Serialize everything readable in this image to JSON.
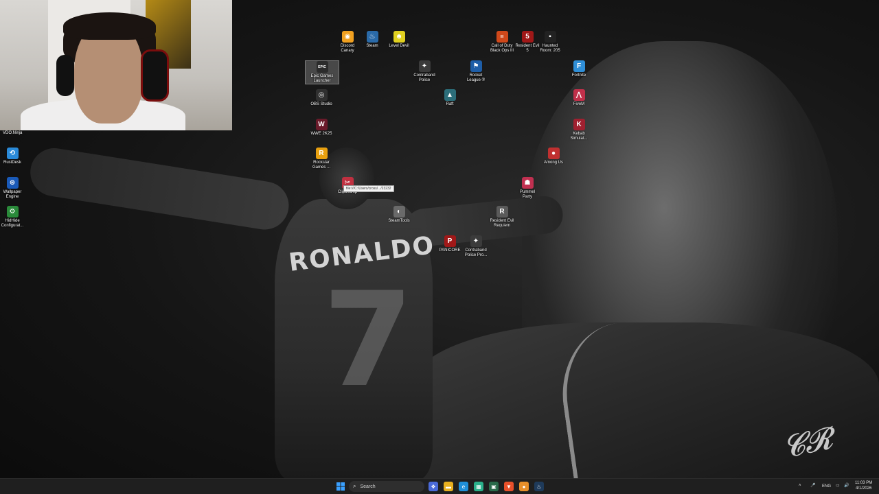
{
  "wallpaper": {
    "jersey_name": "RONALDO",
    "jersey_number": "7",
    "signature": "CR7"
  },
  "webcam": {
    "label": "VDO.Ninja"
  },
  "tooltip": {
    "text": "file:///C:/Users/cross/.../23232"
  },
  "icons": [
    {
      "name": "discord-canary-icon",
      "label": "Discord\nCanary",
      "color": "#f0a020",
      "glyph": "◉"
    },
    {
      "name": "steam-icon",
      "label": "Steam",
      "color": "#2a6aa8",
      "glyph": "♨"
    },
    {
      "name": "level-devil-icon",
      "label": "Level Devil",
      "color": "#e0d020",
      "glyph": "☻"
    },
    {
      "name": "call-of-duty-icon",
      "label": "Call of Duty\nBlack Ops III",
      "color": "#d0481a",
      "glyph": "III"
    },
    {
      "name": "resident-evil-5-icon",
      "label": "Resident Evil\n5",
      "color": "#a01818",
      "glyph": "5"
    },
    {
      "name": "haunted-room-icon",
      "label": "Haunted\nRoom: 205",
      "color": "#222222",
      "glyph": "▪"
    },
    {
      "name": "epic-games-icon",
      "label": "Epic Games\nLauncher",
      "color": "#2b2b2b",
      "glyph": "EPIC"
    },
    {
      "name": "contraband-police-icon",
      "label": "Contraband\nPolice",
      "color": "#3b3b3b",
      "glyph": "✦"
    },
    {
      "name": "rocket-league-icon",
      "label": "Rocket\nLeague ®",
      "color": "#1e5ea8",
      "glyph": "⚑"
    },
    {
      "name": "fortnite-icon",
      "label": "Fortnite",
      "color": "#2f8fd8",
      "glyph": "F"
    },
    {
      "name": "obs-studio-icon",
      "label": "OBS Studio",
      "color": "#303030",
      "glyph": "◎"
    },
    {
      "name": "raft-icon",
      "label": "Raft",
      "color": "#2c6e7a",
      "glyph": "▲"
    },
    {
      "name": "fivem-icon",
      "label": "FiveM",
      "color": "#c0304a",
      "glyph": "⋀"
    },
    {
      "name": "wwe-2k25-icon",
      "label": "WWE 2K25",
      "color": "#6a1a2a",
      "glyph": "W"
    },
    {
      "name": "kebab-simulator-icon",
      "label": "Kebab\nSimulat...",
      "color": "#a02030",
      "glyph": "K"
    },
    {
      "name": "rockstar-games-icon",
      "label": "Rockstar\nGames ...",
      "color": "#e8a010",
      "glyph": "R"
    },
    {
      "name": "among-us-icon",
      "label": "Among Us",
      "color": "#c03030",
      "glyph": "●"
    },
    {
      "name": "clipchamp-icon",
      "label": "Clipchamp",
      "color": "#c03040",
      "glyph": "✂"
    },
    {
      "name": "pummel-party-icon",
      "label": "Pummel\nParty",
      "color": "#c03050",
      "glyph": "☗"
    },
    {
      "name": "steamtools-icon",
      "label": "SteamTools",
      "color": "#6a6a6a",
      "glyph": "◐"
    },
    {
      "name": "resident-evil-requiem-icon",
      "label": "Resident Evil\nRequiem",
      "color": "#5a5a5a",
      "glyph": "R"
    },
    {
      "name": "panicore-icon",
      "label": "PANICORE",
      "color": "#a01818",
      "glyph": "P"
    },
    {
      "name": "contraband-police-prologue-icon",
      "label": "Contraband\nPolice Pro...",
      "color": "#3b3b3b",
      "glyph": "✦"
    },
    {
      "name": "rustdesk-icon",
      "label": "RustDesk",
      "color": "#2a8ad8",
      "glyph": "⟲"
    },
    {
      "name": "wallpaper-engine-icon",
      "label": "Wallpaper\nEngine",
      "color": "#1a5ab8",
      "glyph": "⊛"
    },
    {
      "name": "hidhide-icon",
      "label": "HidHide\nConfigurat...",
      "color": "#2a8a3a",
      "glyph": "⚙"
    }
  ],
  "taskbar": {
    "search_placeholder": "Search",
    "language": "ENG",
    "time": "11:03 PM",
    "date": "4/1/2026",
    "pinned": [
      {
        "name": "widgets-icon",
        "color": "#4a6ad8",
        "glyph": "❖"
      },
      {
        "name": "file-explorer-icon",
        "color": "#e8b020",
        "glyph": "▬"
      },
      {
        "name": "edge-icon",
        "color": "#1f8fd8",
        "glyph": "e"
      },
      {
        "name": "store-icon",
        "color": "#2ab08a",
        "glyph": "▦"
      },
      {
        "name": "app-green-icon",
        "color": "#2a6a4a",
        "glyph": "▣"
      },
      {
        "name": "brave-icon",
        "color": "#e8502a",
        "glyph": "▼"
      },
      {
        "name": "app-orange-icon",
        "color": "#e8902a",
        "glyph": "●"
      },
      {
        "name": "steam-taskbar-icon",
        "color": "#1e3a5a",
        "glyph": "♨"
      },
      {
        "name": "app-red-icon",
        "color": "#a82a2a",
        "glyph": "◍"
      }
    ]
  }
}
